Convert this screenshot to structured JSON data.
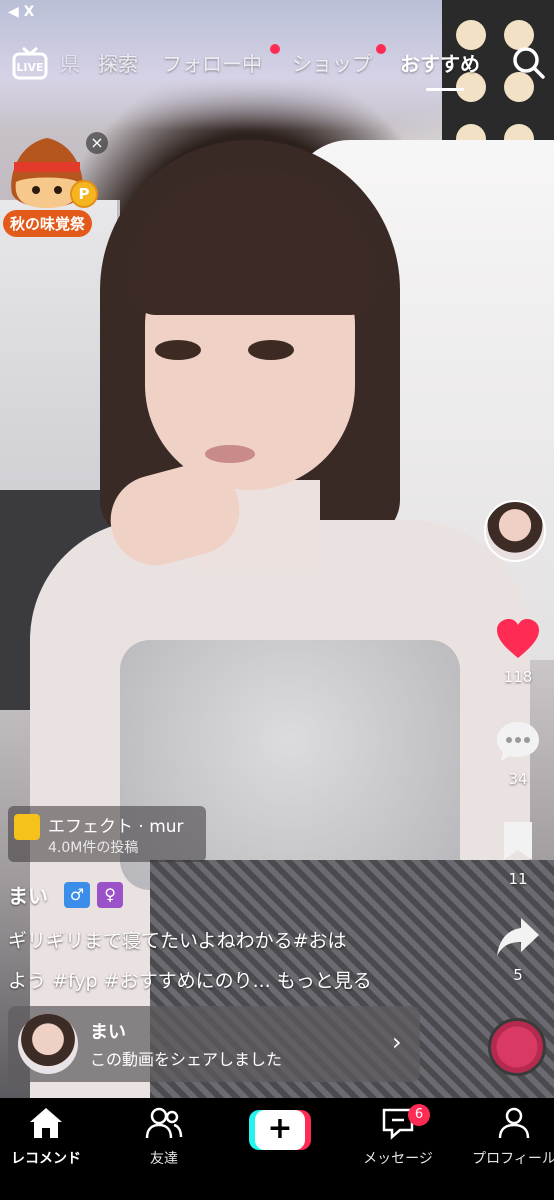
{
  "status_bar": {
    "back_label": "◀ X"
  },
  "top_nav": {
    "tabs": [
      {
        "label": "県"
      },
      {
        "label": "探索"
      },
      {
        "label": "フォロー中"
      },
      {
        "label": "ショップ"
      },
      {
        "label": "おすすめ"
      }
    ],
    "live_icon": "live-tv-icon",
    "search_icon": "search-icon"
  },
  "promo": {
    "label": "秋の味覚祭",
    "coin_letter": "P",
    "close_glyph": "×"
  },
  "right_rail": {
    "likes": "118",
    "comments": "34",
    "saves": "11",
    "shares": "5",
    "colors": {
      "like": "#fe2c55"
    }
  },
  "effect": {
    "title": "エフェクト · mur",
    "posts": "4.0M件の投稿"
  },
  "post": {
    "username": "まい",
    "caption_line1": "ギリギリまで寝てたいよねわかる#おは",
    "caption_line2": "よう #fyp #おすすめにのり... もっと見る"
  },
  "share_card": {
    "name": "まい",
    "text": "この動画をシェアしました",
    "chevron": "›"
  },
  "bottom_nav": {
    "home_label": "レコメンド",
    "friends_label": "友達",
    "create_label": "+",
    "messages_label": "メッセージ",
    "messages_badge": "6",
    "profile_label": "プロフィール"
  }
}
